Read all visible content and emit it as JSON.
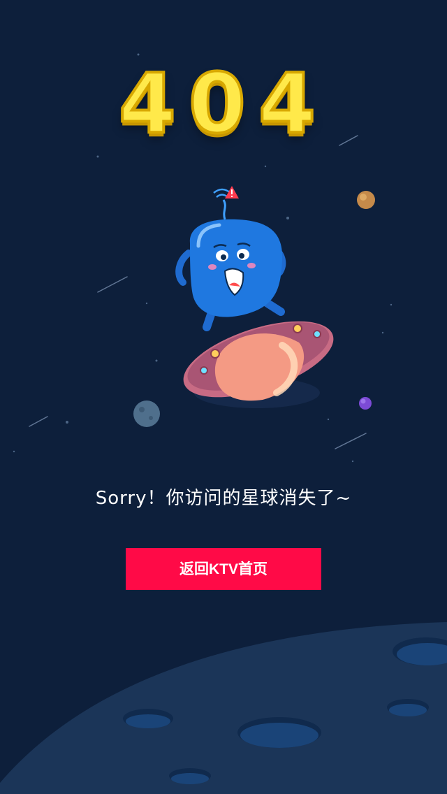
{
  "error": {
    "code": "404",
    "message": "Sorry！你访问的星球消失了~"
  },
  "actions": {
    "home_button_label": "返回KTV首页"
  },
  "icons": {
    "warning": "warning-icon",
    "signal": "signal-icon"
  },
  "colors": {
    "background": "#0d1f3b",
    "title": "#ffe94a",
    "button": "#ff0a47",
    "planet": "#1b3558",
    "robot": "#1f78e0",
    "ufo": "#d66b6b"
  }
}
